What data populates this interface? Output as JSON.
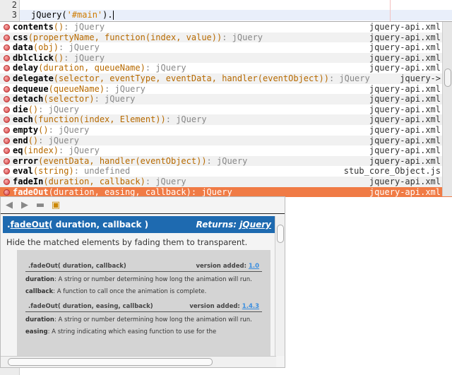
{
  "editor": {
    "lines": [
      {
        "num": "2",
        "text": ""
      },
      {
        "num": "3",
        "prefix": "jQuery(",
        "string": "'#main'",
        "suffix": ")."
      }
    ]
  },
  "completion": {
    "items": [
      {
        "name": "contents",
        "params": "()",
        "ret": ": jQuery",
        "src": "jquery-api.xml"
      },
      {
        "name": "css",
        "params": "(propertyName, function(index, value))",
        "ret": ": jQuery",
        "src": "jquery-api.xml"
      },
      {
        "name": "data",
        "params": "(obj)",
        "ret": ": jQuery",
        "src": "jquery-api.xml"
      },
      {
        "name": "dblclick",
        "params": "()",
        "ret": ": jQuery",
        "src": "jquery-api.xml"
      },
      {
        "name": "delay",
        "params": "(duration, queueName)",
        "ret": ": jQuery",
        "src": "jquery-api.xml"
      },
      {
        "name": "delegate",
        "params": "(selector, eventType, eventData, handler(eventObject))",
        "ret": ": jQuery",
        "src": "jquery->"
      },
      {
        "name": "dequeue",
        "params": "(queueName)",
        "ret": ": jQuery",
        "src": "jquery-api.xml"
      },
      {
        "name": "detach",
        "params": "(selector)",
        "ret": ": jQuery",
        "src": "jquery-api.xml"
      },
      {
        "name": "die",
        "params": "()",
        "ret": ": jQuery",
        "src": "jquery-api.xml"
      },
      {
        "name": "each",
        "params": "(function(index, Element))",
        "ret": ": jQuery",
        "src": "jquery-api.xml"
      },
      {
        "name": "empty",
        "params": "()",
        "ret": ": jQuery",
        "src": "jquery-api.xml"
      },
      {
        "name": "end",
        "params": "()",
        "ret": ": jQuery",
        "src": "jquery-api.xml"
      },
      {
        "name": "eq",
        "params": "(index)",
        "ret": ": jQuery",
        "src": "jquery-api.xml"
      },
      {
        "name": "error",
        "params": "(eventData, handler(eventObject))",
        "ret": ": jQuery",
        "src": "jquery-api.xml"
      },
      {
        "name": "eval",
        "params": "(string)",
        "ret": ": undefined",
        "src": "stub_core_Object.js"
      },
      {
        "name": "fadeIn",
        "params": "(duration, callback)",
        "ret": ": jQuery",
        "src": "jquery-api.xml"
      },
      {
        "name": "fadeOut",
        "params": "(duration, easing, callback)",
        "ret": ": jQuery",
        "src": "jquery-api.xml",
        "selected": true
      }
    ]
  },
  "doc": {
    "toolbar": {
      "back": "back-icon",
      "forward": "forward-icon",
      "source": "goto-source-icon",
      "browser": "open-browser-icon"
    },
    "title_dot": ".",
    "title_name": "fadeOut",
    "title_rest": "( duration, callback )",
    "returns_label": "Returns: ",
    "returns_type": "jQuery",
    "description": "Hide the matched elements by fading them to transparent.",
    "signatures": [
      {
        "sig": ".fadeOut( duration, callback)",
        "version_label": "version added: ",
        "version": "1.0",
        "params": [
          {
            "name": "duration",
            "text": ": A string or number determining how long the animation will run."
          },
          {
            "name": "callback",
            "text": ": A function to call once the animation is complete."
          }
        ]
      },
      {
        "sig": ".fadeOut( duration, easing, callback)",
        "version_label": "version added: ",
        "version": "1.4.3",
        "params": [
          {
            "name": "duration",
            "text": ": A string or number determining how long the animation will run."
          },
          {
            "name": "easing",
            "text": ": A string indicating which easing function to use for the"
          }
        ]
      }
    ]
  }
}
